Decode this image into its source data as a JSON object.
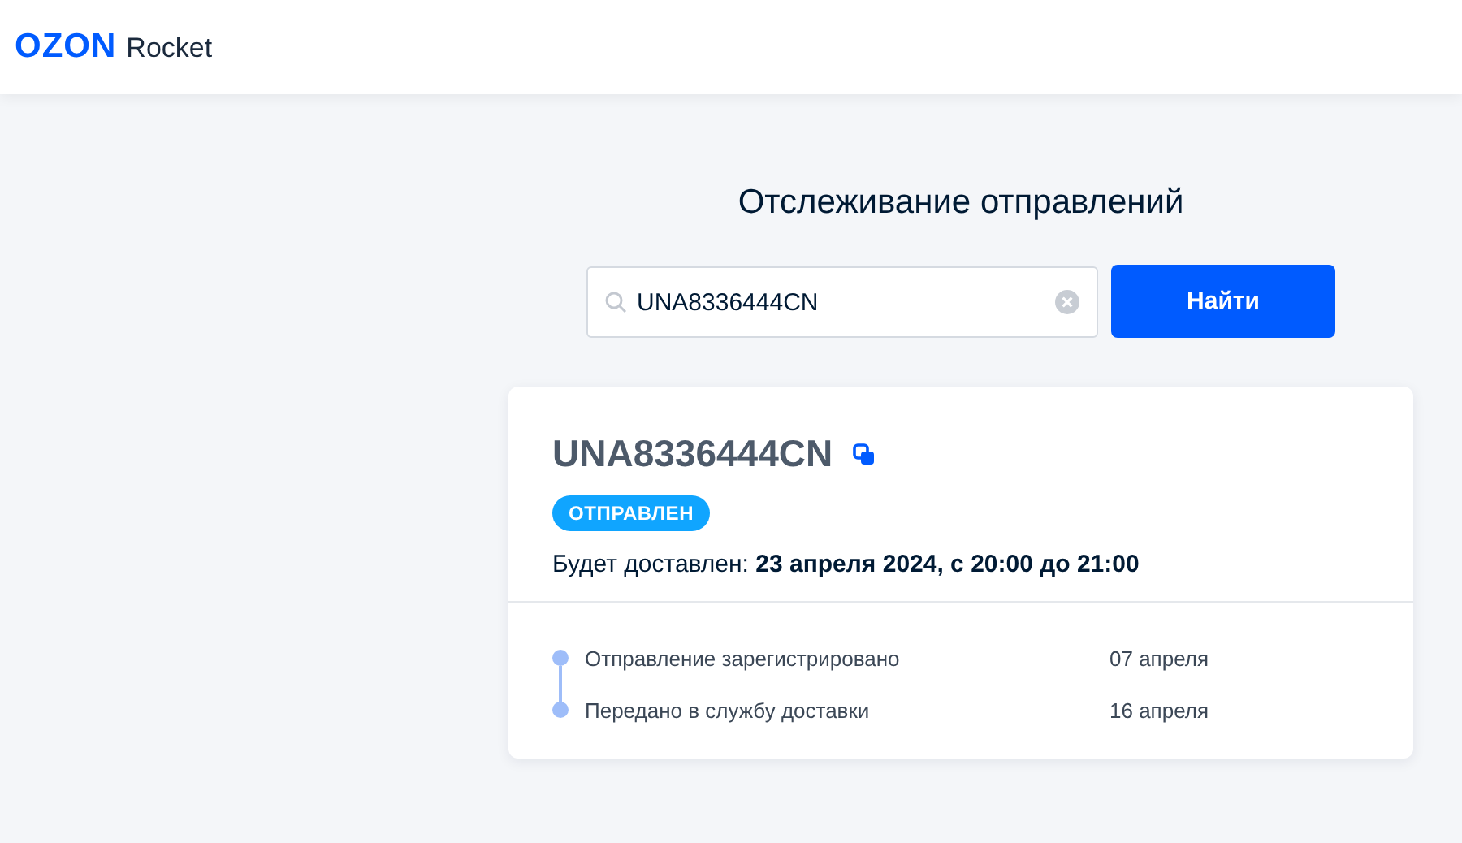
{
  "header": {
    "logo_brand": "OZON",
    "logo_product": "Rocket"
  },
  "page_title": "Отслеживание отправлений",
  "search": {
    "value": "UNA8336444CN",
    "button": "Найти"
  },
  "shipment": {
    "tracking_number": "UNA8336444CN",
    "status": "ОТПРАВЛЕН",
    "delivery": "Будет доставлен: **23 апреля 2024, с 20:00 до 21:00**",
    "events": [
      {
        "label": "Отправление зарегистрировано",
        "date": "07 апреля"
      },
      {
        "label": "Передано в службу доставки",
        "date": "16 апреля"
      }
    ]
  }
}
